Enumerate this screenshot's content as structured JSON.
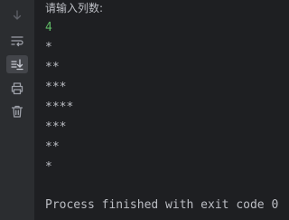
{
  "toolbar": {
    "buttons": [
      {
        "name": "scroll-down-icon",
        "active": false
      },
      {
        "name": "soft-wrap-icon",
        "active": false
      },
      {
        "name": "scroll-to-end-icon",
        "active": true
      },
      {
        "name": "print-icon",
        "active": false
      },
      {
        "name": "clear-all-icon",
        "active": false
      }
    ]
  },
  "console": {
    "prompt": "请输入列数:",
    "user_input": "4",
    "output_lines": [
      "*",
      "**",
      "***",
      "****",
      "***",
      "**",
      "*"
    ],
    "exit_message": "Process finished with exit code 0"
  },
  "colors": {
    "background": "#1e1f22",
    "gutter": "#2b2d30",
    "text": "#bcbec4",
    "user_input": "#5fb865",
    "icon": "#9da0a8"
  }
}
